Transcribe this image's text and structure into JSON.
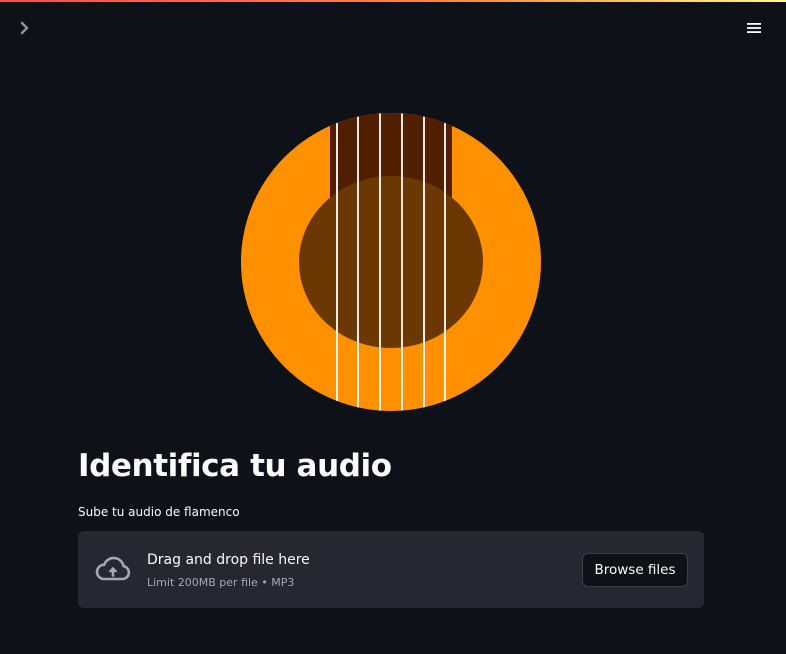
{
  "header": {
    "sidebar_toggle_icon": "chevron-right-icon",
    "menu_icon": "hamburger-menu-icon"
  },
  "logo": {
    "icon": "guitar-soundhole-logo",
    "colors": {
      "body": "#ff9000",
      "fretboard": "#4f1f00",
      "soundhole": "#6b3804",
      "strings": "#ffffff"
    }
  },
  "main": {
    "title": "Identifica tu audio",
    "uploader": {
      "label": "Sube tu audio de flamenco",
      "icon": "cloud-upload-icon",
      "drop_title": "Drag and drop file here",
      "limit_text": "Limit 200MB per file • MP3",
      "browse_label": "Browse files"
    }
  },
  "colors": {
    "background": "#0e1117",
    "dropzone": "#262730",
    "text": "#fafafa",
    "muted_text": "#a3a8b4",
    "accent": "#ff4b4b"
  }
}
